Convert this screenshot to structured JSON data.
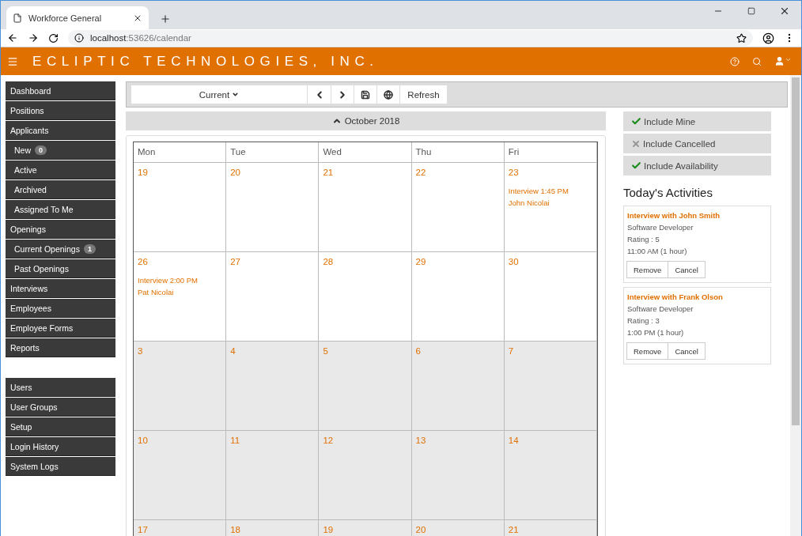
{
  "browser": {
    "tab_title": "Workforce General",
    "url_host": "localhost",
    "url_path": ":53626/calendar"
  },
  "header": {
    "brand": "ECLIPTIC TECHNOLOGIES, INC."
  },
  "sidebar": {
    "groups": [
      {
        "items": [
          {
            "label": "Dashboard"
          },
          {
            "label": "Positions"
          },
          {
            "label": "Applicants",
            "children": [
              {
                "label": "New",
                "badge": "0"
              },
              {
                "label": "Active"
              },
              {
                "label": "Archived"
              },
              {
                "label": "Assigned To Me"
              }
            ]
          },
          {
            "label": "Openings",
            "children": [
              {
                "label": "Current Openings",
                "badge": "1"
              },
              {
                "label": "Past Openings"
              }
            ]
          },
          {
            "label": "Interviews"
          },
          {
            "label": "Employees"
          },
          {
            "label": "Employee Forms"
          },
          {
            "label": "Reports"
          }
        ]
      },
      {
        "items": [
          {
            "label": "Users"
          },
          {
            "label": "User Groups"
          },
          {
            "label": "Setup"
          },
          {
            "label": "Login History"
          },
          {
            "label": "System Logs"
          }
        ]
      }
    ]
  },
  "toolbar": {
    "period": "Current",
    "refresh": "Refresh"
  },
  "calendar": {
    "month": "October 2018",
    "weekdays": [
      "Mon",
      "Tue",
      "Wed",
      "Thu",
      "Fri"
    ],
    "weeks": [
      {
        "muted": false,
        "days": [
          {
            "number": "19"
          },
          {
            "number": "20"
          },
          {
            "number": "21"
          },
          {
            "number": "22"
          },
          {
            "number": "23",
            "events": [
              {
                "title": "Interview 1:45 PM",
                "person": "John Nicolai"
              }
            ]
          }
        ]
      },
      {
        "muted": false,
        "days": [
          {
            "number": "26",
            "events": [
              {
                "title": "Interview 2:00 PM",
                "person": "Pat Nicolai"
              }
            ]
          },
          {
            "number": "27"
          },
          {
            "number": "28"
          },
          {
            "number": "29"
          },
          {
            "number": "30"
          }
        ]
      },
      {
        "muted": true,
        "days": [
          {
            "number": "3"
          },
          {
            "number": "4"
          },
          {
            "number": "5"
          },
          {
            "number": "6"
          },
          {
            "number": "7"
          }
        ]
      },
      {
        "muted": true,
        "days": [
          {
            "number": "10"
          },
          {
            "number": "11"
          },
          {
            "number": "12"
          },
          {
            "number": "13"
          },
          {
            "number": "14"
          }
        ]
      },
      {
        "muted": true,
        "days": [
          {
            "number": "17"
          },
          {
            "number": "18"
          },
          {
            "number": "19"
          },
          {
            "number": "20"
          },
          {
            "number": "21"
          }
        ]
      }
    ]
  },
  "filters": [
    {
      "label": "Include Mine",
      "on": true
    },
    {
      "label": "Include Cancelled",
      "on": false
    },
    {
      "label": "Include Availability",
      "on": true
    }
  ],
  "activities": {
    "title": "Today's Activities",
    "items": [
      {
        "title": "Interview with John Smith",
        "position": "Software Developer",
        "rating": "Rating : 5",
        "time": "11:00 AM (1 hour)",
        "buttons": [
          "Remove",
          "Cancel"
        ]
      },
      {
        "title": "Interview with Frank Olson",
        "position": "Software Developer",
        "rating": "Rating : 3",
        "time": "1:00 PM (1 hour)",
        "buttons": [
          "Remove",
          "Cancel"
        ]
      }
    ]
  }
}
